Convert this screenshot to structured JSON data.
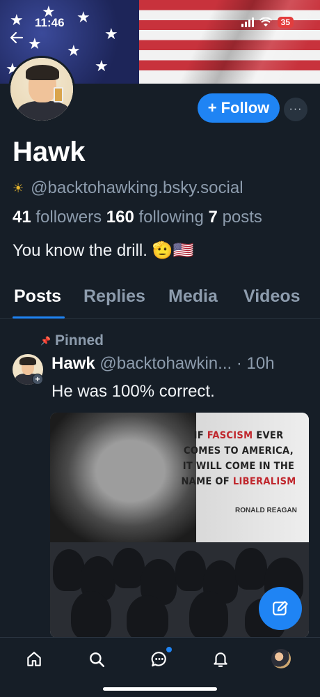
{
  "status_bar": {
    "time": "11:46",
    "battery": "35"
  },
  "profile": {
    "name": "Hawk",
    "handle": "@backtohawking.bsky.social",
    "followers_count": "41",
    "followers_label": "followers",
    "following_count": "160",
    "following_label": "following",
    "posts_count": "7",
    "posts_label": "posts",
    "bio": "You know the drill. 🫡🇺🇸"
  },
  "actions": {
    "follow_label": "Follow",
    "more_label": "···"
  },
  "tabs": [
    {
      "label": "Posts",
      "active": true
    },
    {
      "label": "Replies",
      "active": false
    },
    {
      "label": "Media",
      "active": false
    },
    {
      "label": "Videos",
      "active": false
    }
  ],
  "post": {
    "pinned_label": "Pinned",
    "author_name": "Hawk",
    "author_handle": "@backtohawkin...",
    "separator": "·",
    "time": "10h",
    "text": "He was 100% correct.",
    "image": {
      "quote_line1_a": "IF ",
      "quote_line1_b": "FASCISM",
      "quote_line1_c": " EVER",
      "quote_line2": "COMES TO AMERICA,",
      "quote_line3": "IT WILL COME IN THE",
      "quote_line4_a": "NAME OF ",
      "quote_line4_b": "LIBERALISM",
      "attribution": "RONALD REAGAN"
    }
  },
  "colors": {
    "accent": "#1f84f4",
    "background": "#161e27",
    "muted": "#8d9cad"
  },
  "nav": [
    "home-icon",
    "search-icon",
    "chat-icon",
    "bell-icon",
    "profile-avatar"
  ]
}
